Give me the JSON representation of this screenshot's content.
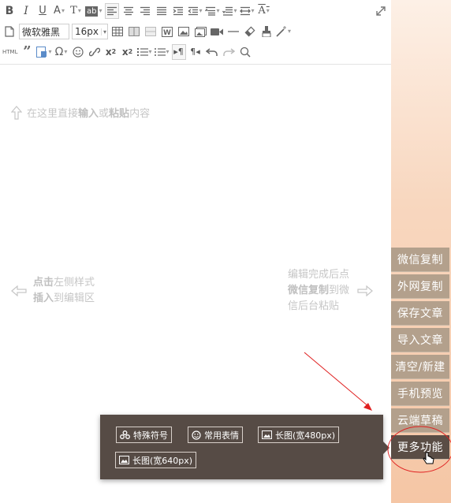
{
  "toolbar": {
    "font_family_value": "微软雅黑",
    "font_size_value": "16px",
    "html_label": "HTML"
  },
  "editor": {
    "hint_top": {
      "pre": "在这里直接",
      "bold1": "输入",
      "mid": "或",
      "bold2": "粘贴",
      "post": "内容"
    },
    "hint_left": {
      "line1_bold": "点击",
      "line1_rest": "左侧样式",
      "line2_bold": "插入",
      "line2_rest": "到编辑区"
    },
    "hint_right": {
      "line1": "编辑完成后点",
      "line2_bold": "微信复制",
      "line2_rest": "到微",
      "line3": "信后台粘贴"
    }
  },
  "sidebar": {
    "items": [
      {
        "label": "微信复制"
      },
      {
        "label": "外网复制"
      },
      {
        "label": "保存文章"
      },
      {
        "label": "导入文章"
      },
      {
        "label": "清空/新建"
      },
      {
        "label": "手机预览"
      },
      {
        "label": "云端草稿"
      },
      {
        "label": "更多功能"
      }
    ]
  },
  "popup": {
    "items": [
      {
        "label": "特殊符号",
        "icon": "cluster-icon"
      },
      {
        "label": "常用表情",
        "icon": "smile-icon"
      },
      {
        "label": "长图(宽480px)",
        "icon": "image-icon"
      },
      {
        "label": "长图(宽640px)",
        "icon": "image-icon"
      }
    ]
  },
  "colors": {
    "sidebar_button": "#b3a08c",
    "sidebar_button_active": "#5a4d45",
    "popup_bg": "#564b45",
    "annotation": "#e02020"
  }
}
